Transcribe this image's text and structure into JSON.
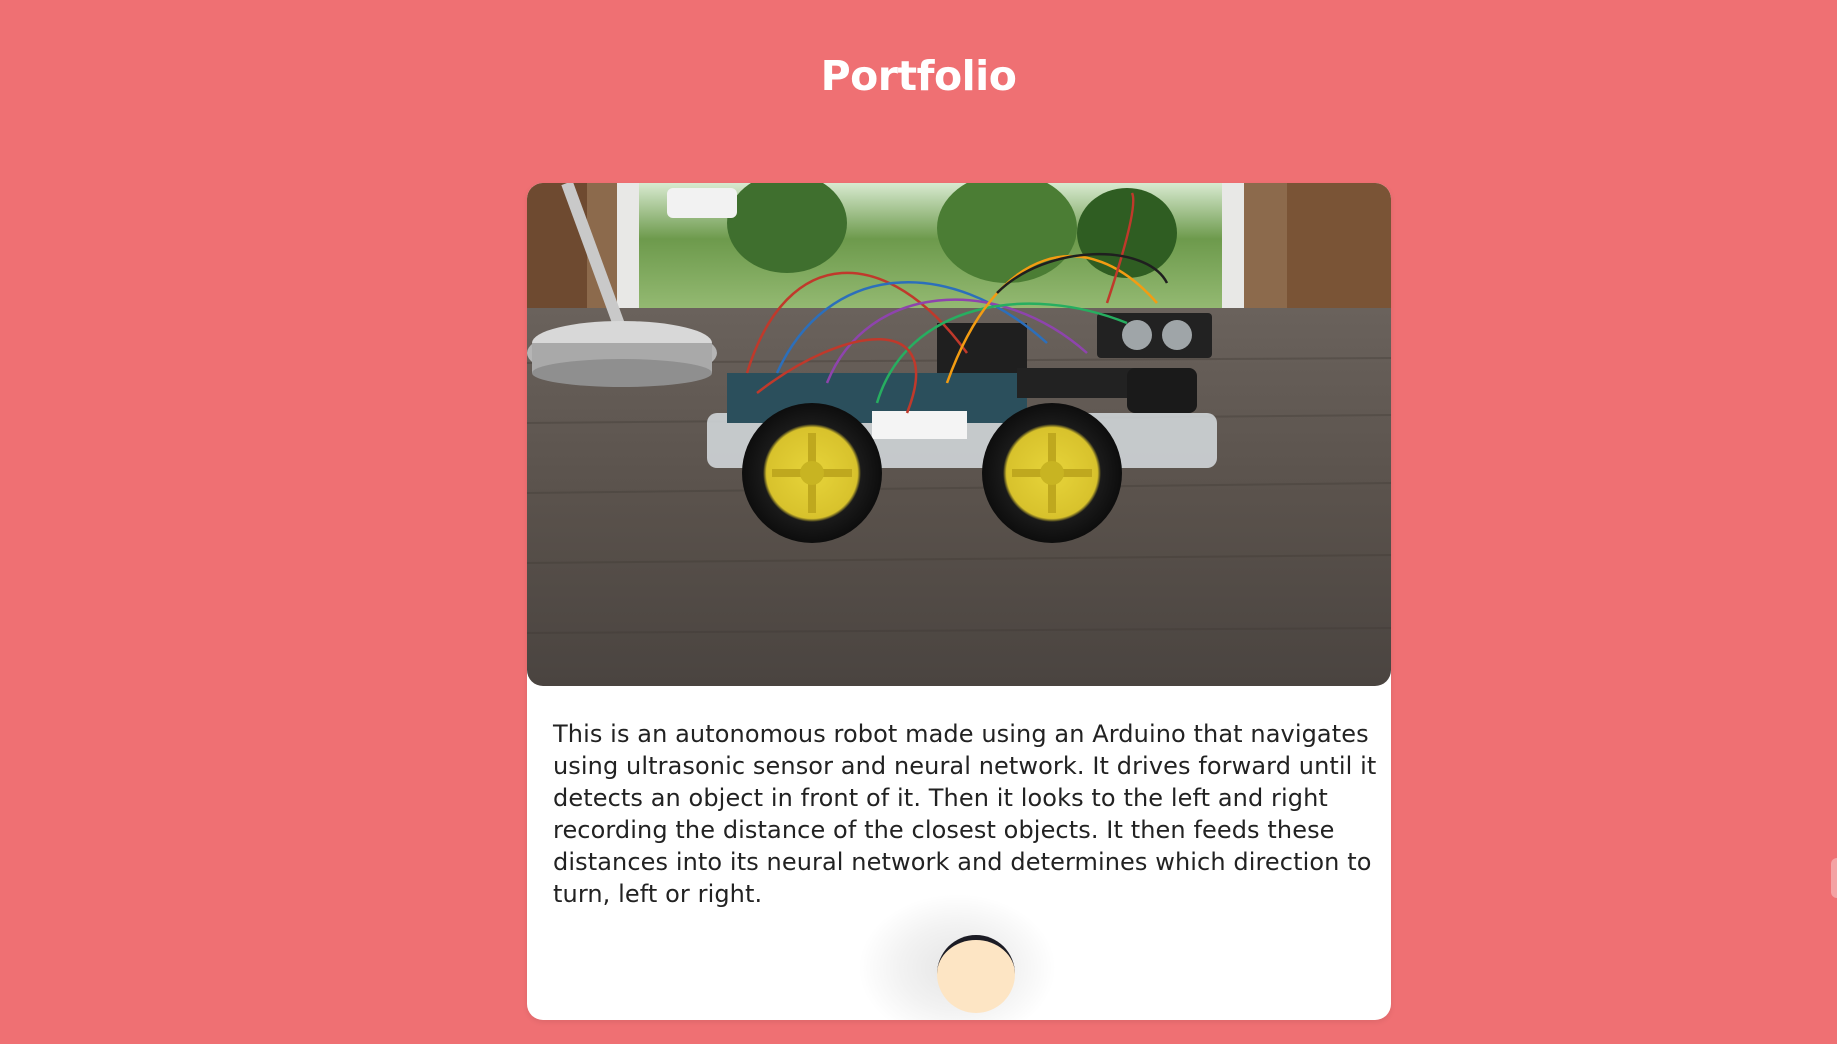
{
  "header": {
    "title": "Portfolio"
  },
  "project": {
    "image_alt": "Autonomous Arduino robot car with ultrasonic sensor on a wooden table",
    "description": "This is an autonomous robot made using an Arduino that navigates using ultrasonic sensor and neural network. It drives forward until it detects an object in front of it. Then it looks to the left and right recording the distance of the closest objects. It then feeds these distances into its neural network and determines which direction to turn, left or right."
  },
  "colors": {
    "background": "#ef7073",
    "card": "#ffffff",
    "title_text": "#ffffff",
    "body_text": "#222222",
    "toggle_fill": "#fde5c4"
  },
  "icons": {
    "toggle": "half-moon-toggle-icon"
  }
}
